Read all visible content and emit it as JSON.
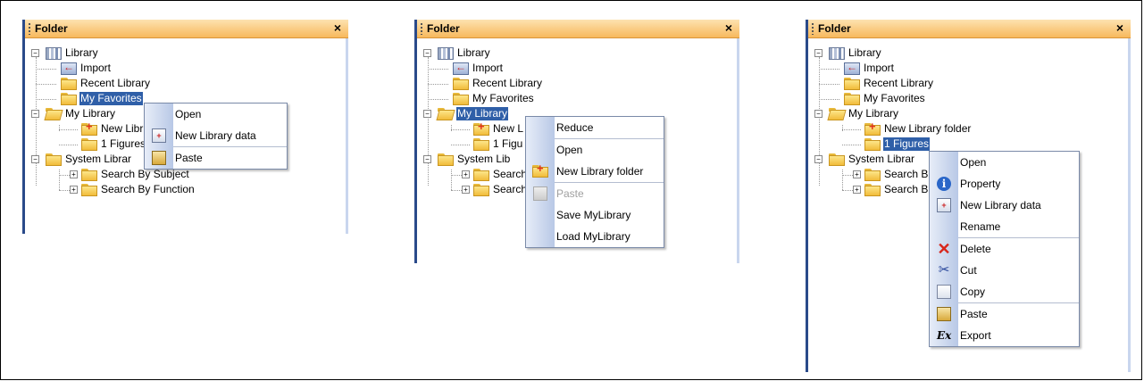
{
  "panels": [
    {
      "title": "Folder",
      "close": "×",
      "tree": {
        "root": "Library",
        "items": [
          "Import",
          "Recent Library",
          "My Favorites",
          "My Library",
          "New Libr",
          "1 Figures",
          "System Librar",
          "Search By Subject",
          "Search By Function"
        ]
      },
      "menu": [
        {
          "label": "Open",
          "icon": ""
        },
        {
          "label": "New Library data",
          "icon": "new-library-data-icon"
        },
        {
          "label": "Paste",
          "icon": "paste-icon"
        }
      ]
    },
    {
      "title": "Folder",
      "close": "×",
      "tree": {
        "root": "Library",
        "items": [
          "Import",
          "Recent Library",
          "My Favorites",
          "My Library",
          "New L",
          "1 Figu",
          "System Lib",
          "Search",
          "Search"
        ]
      },
      "menu": [
        {
          "label": "Reduce",
          "icon": ""
        },
        {
          "label": "Open",
          "icon": ""
        },
        {
          "label": "New Library folder",
          "icon": "new-folder-icon"
        },
        {
          "label": "Paste",
          "icon": "paste-icon",
          "disabled": true
        },
        {
          "label": "Save MyLibrary",
          "icon": ""
        },
        {
          "label": "Load MyLibrary",
          "icon": ""
        }
      ]
    },
    {
      "title": "Folder",
      "close": "×",
      "tree": {
        "root": "Library",
        "items": [
          "Import",
          "Recent Library",
          "My Favorites",
          "My Library",
          "New Library folder",
          "1 Figures",
          "System Librar",
          "Search B",
          "Search B"
        ]
      },
      "menu": [
        {
          "label": "Open",
          "icon": ""
        },
        {
          "label": "Property",
          "icon": "info-icon"
        },
        {
          "label": "New Library data",
          "icon": "new-library-data-icon"
        },
        {
          "label": "Rename",
          "icon": ""
        },
        {
          "label": "Delete",
          "icon": "delete-icon"
        },
        {
          "label": "Cut",
          "icon": "scissors-icon"
        },
        {
          "label": "Copy",
          "icon": "copy-icon"
        },
        {
          "label": "Paste",
          "icon": "paste-icon"
        },
        {
          "label": "Export",
          "icon": "export-icon"
        }
      ]
    }
  ],
  "colors": {
    "title_gradient_top": "#fde2b0",
    "title_gradient_bottom": "#f7b95d",
    "selection": "#2f5fa8",
    "panel_edge": "#2a4a8a"
  }
}
